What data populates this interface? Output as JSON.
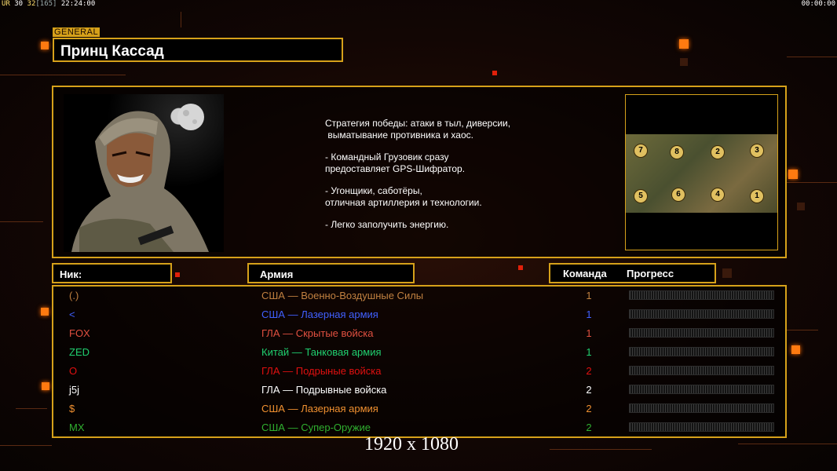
{
  "status_bar": {
    "left_prefix": "UR",
    "left_val1": "30",
    "left_val2": "32",
    "left_bracket": "[165]",
    "left_time": "22:24:00",
    "right_time": "00:00:00"
  },
  "general": {
    "tag": "GENERAL",
    "name": "Принц Кассад"
  },
  "description": [
    "Стратегия победы: атаки в тыл, диверсии,\n выматывание противника и хаос.",
    "- Командный Грузовик сразу\nпредоставляет GPS-Шифратор.",
    "- Угонщики, саботёры,\nотличная артиллерия и технологии.",
    "- Легко заполучить энергию."
  ],
  "minimap": {
    "slots": [
      "7",
      "8",
      "2",
      "3",
      "5",
      "6",
      "4",
      "1"
    ]
  },
  "headers": {
    "nick": "Ник:",
    "army": "Армия",
    "team": "Команда",
    "progress": "Прогресс"
  },
  "players": [
    {
      "nick": "(.)",
      "army": "США — Военно-Воздушные Силы",
      "team": "1",
      "progress": 0,
      "color": "#c08040"
    },
    {
      "nick": "<",
      "army": "США — Лазерная армия",
      "team": "1",
      "progress": 0,
      "color": "#4060ff"
    },
    {
      "nick": "FOX",
      "army": "ГЛА — Скрытые войска",
      "team": "1",
      "progress": 0,
      "color": "#e05040"
    },
    {
      "nick": "ZED",
      "army": "Китай — Танковая армия",
      "team": "1",
      "progress": 0,
      "color": "#20d070"
    },
    {
      "nick": "O",
      "army": "ГЛА — Подрыные войска",
      "team": "2",
      "progress": 0,
      "color": "#e01010"
    },
    {
      "nick": "j5j",
      "army": "ГЛА — Подрывные войска",
      "team": "2",
      "progress": 0,
      "color": "#ffffff"
    },
    {
      "nick": "$",
      "army": "США — Лазерная армия",
      "team": "2",
      "progress": 0,
      "color": "#f09030"
    },
    {
      "nick": "MX",
      "army": "США — Супер-Оружие",
      "team": "2",
      "progress": 0,
      "color": "#30b030"
    }
  ],
  "resolution_label": "1920 x 1080",
  "colors": {
    "frame_gold": "#d6a11a",
    "accent_orange": "#ff7a10",
    "background": "#0e0604"
  }
}
